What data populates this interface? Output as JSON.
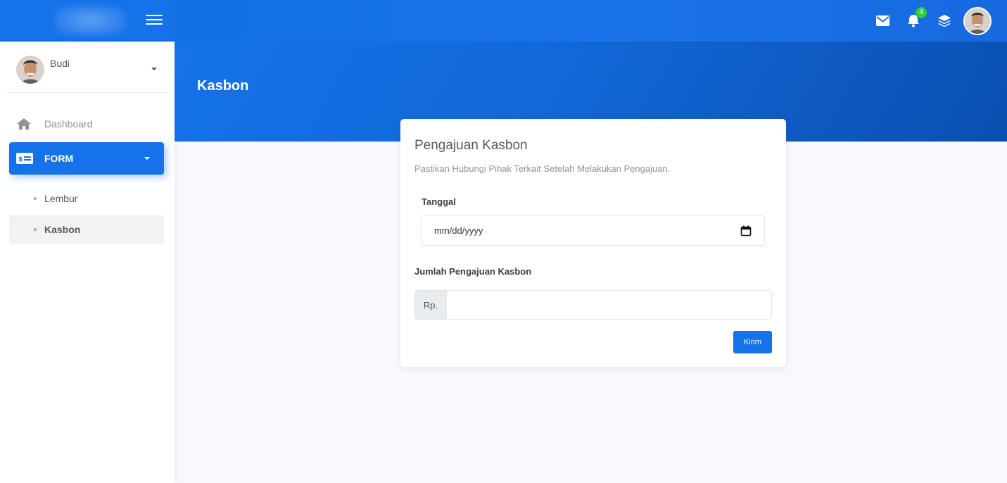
{
  "topbar": {
    "notification_count": "4",
    "icons": [
      "envelope-icon",
      "bell-icon",
      "layers-icon"
    ]
  },
  "sidebar": {
    "user": {
      "name": "Budi"
    },
    "items": [
      {
        "label": "Dashboard",
        "icon": "home-icon"
      },
      {
        "label": "FORM",
        "icon": "money-check-icon",
        "active": true
      }
    ],
    "subitems": [
      {
        "label": "Lembur"
      },
      {
        "label": "Kasbon",
        "active": true
      }
    ]
  },
  "page": {
    "title": "Kasbon"
  },
  "form": {
    "title": "Pengajuan Kasbon",
    "subtitle": "Pastikan Hubungi Pihak Terkait Setelah Melakukan Pengajuan.",
    "date_label": "Tanggal",
    "date_placeholder": "mm/dd/yyyy",
    "amount_label": "Jumlah Pengajuan Kasbon",
    "amount_prefix": "Rp.",
    "amount_value": "",
    "submit_label": "Kirim"
  },
  "colors": {
    "primary": "#1572e8",
    "badge": "#31ce36",
    "active_sub_bg": "#f2f2f2"
  }
}
